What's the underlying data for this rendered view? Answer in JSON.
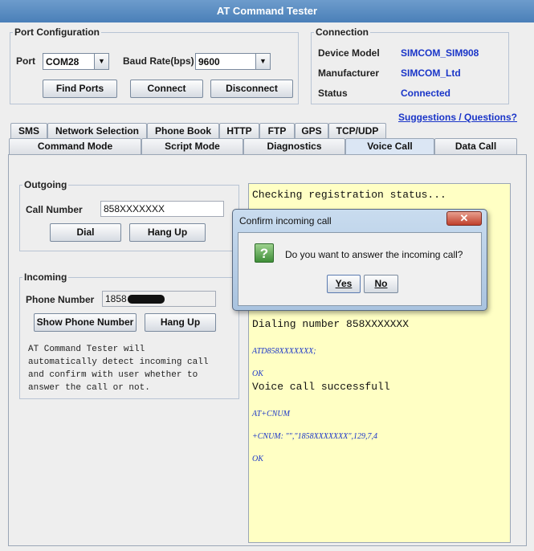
{
  "window": {
    "title": "AT Command Tester"
  },
  "port_config": {
    "title": "Port Configuration",
    "port_label": "Port",
    "port_value": "COM28",
    "baud_label": "Baud Rate(bps)",
    "baud_value": "9600",
    "find_ports": "Find Ports",
    "connect": "Connect",
    "disconnect": "Disconnect"
  },
  "connection": {
    "title": "Connection",
    "device_model_label": "Device Model",
    "device_model_value": "SIMCOM_SIM908",
    "manufacturer_label": "Manufacturer",
    "manufacturer_value": "SIMCOM_Ltd",
    "status_label": "Status",
    "status_value": "Connected"
  },
  "suggestions_link": "Suggestions / Questions?",
  "tabs_row1": [
    "SMS",
    "Network Selection",
    "Phone Book",
    "HTTP",
    "FTP",
    "GPS",
    "TCP/UDP"
  ],
  "tabs_row2": [
    "Command Mode",
    "Script Mode",
    "Diagnostics",
    "Voice Call",
    "Data Call"
  ],
  "active_tab": "Voice Call",
  "outgoing": {
    "title": "Outgoing",
    "call_number_label": "Call Number",
    "call_number_value": "858XXXXXXX",
    "dial": "Dial",
    "hang_up": "Hang Up"
  },
  "incoming": {
    "title": "Incoming",
    "phone_number_label": "Phone Number",
    "phone_number_value": "1858",
    "show_phone_number": "Show Phone Number",
    "hang_up": "Hang Up",
    "description_lines": [
      "AT Command Tester will",
      "automatically detect incoming call",
      "and confirm with user whether to",
      "answer the call or not."
    ]
  },
  "console": {
    "line1": "Checking registration status...",
    "line2": "Dialing number 858XXXXXXX",
    "line3": "ATD858XXXXXXX;",
    "line4": "OK",
    "line5": "Voice call successfull",
    "line6": "AT+CNUM",
    "line7": "+CNUM: \"\",\"1858XXXXXXX\",129,7,4",
    "line8": "OK"
  },
  "dialog": {
    "title": "Confirm incoming call",
    "close": "✕",
    "icon": "?",
    "message": "Do you want to answer the incoming call?",
    "yes": "Yes",
    "no": "No"
  }
}
